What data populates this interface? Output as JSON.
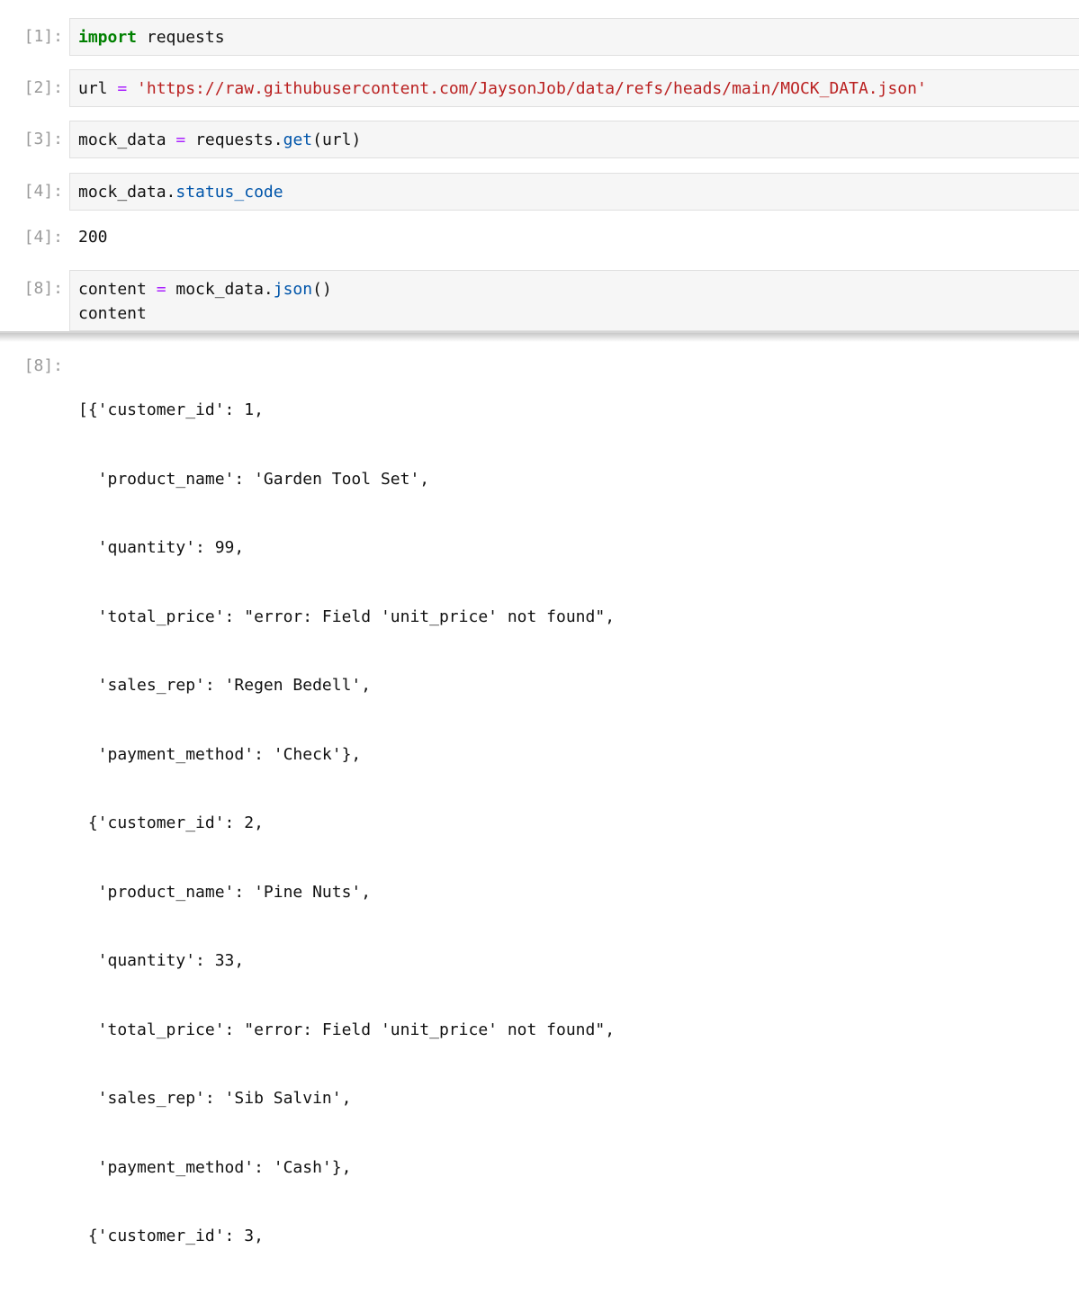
{
  "cells": {
    "c1": {
      "prompt": "[1]:",
      "keyword": "import",
      "module": " requests"
    },
    "c2": {
      "prompt": "[2]:",
      "var": "url",
      "op": " = ",
      "value": "'https://raw.githubusercontent.com/JaysonJob/data/refs/heads/main/MOCK_DATA.json'"
    },
    "c3": {
      "prompt": "[3]:",
      "var": "mock_data",
      "op": " = ",
      "obj": "requests.",
      "method": "get",
      "args": "(url)"
    },
    "c4": {
      "prompt": "[4]:",
      "obj": "mock_data.",
      "attr": "status_code",
      "out_prompt": "[4]:",
      "output": "200"
    },
    "c8": {
      "prompt": "[8]:",
      "var": "content",
      "op": " = ",
      "obj": "mock_data.",
      "method": "json",
      "args": "()",
      "line2": "content",
      "out_prompt": "[8]:",
      "output_lines": [
        "[{'customer_id': 1,",
        "  'product_name': 'Garden Tool Set',",
        "  'quantity': 99,",
        "  'total_price': \"error: Field 'unit_price' not found\",",
        "  'sales_rep': 'Regen Bedell',",
        "  'payment_method': 'Check'},",
        " {'customer_id': 2,",
        "  'product_name': 'Pine Nuts',",
        "  'quantity': 33,",
        "  'total_price': \"error: Field 'unit_price' not found\",",
        "  'sales_rep': 'Sib Salvin',",
        "  'payment_method': 'Cash'},",
        " {'customer_id': 3,"
      ]
    }
  }
}
